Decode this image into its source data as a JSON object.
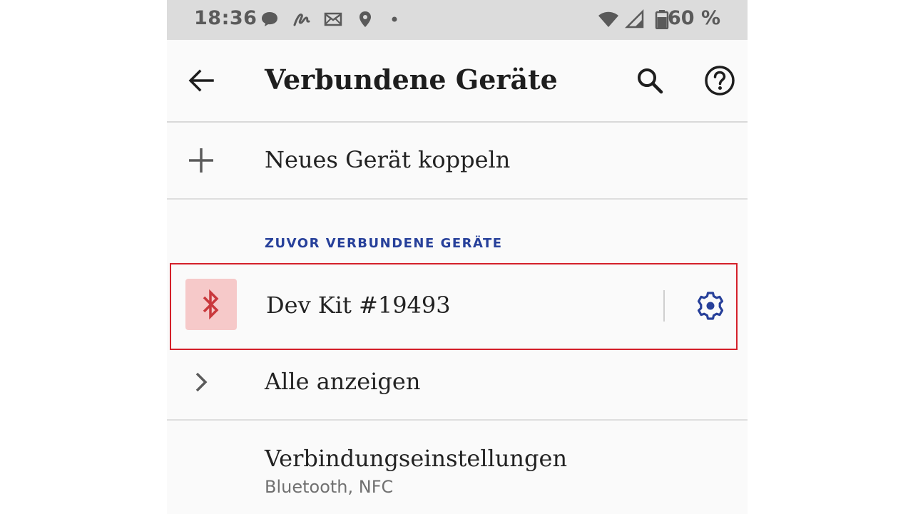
{
  "status_bar": {
    "time": "18:36",
    "battery": "60 %",
    "icons": [
      "chat-icon",
      "signature-icon",
      "mail-icon",
      "location-icon",
      "dot-icon",
      "wifi-icon",
      "cell-signal-icon",
      "battery-icon"
    ]
  },
  "app_bar": {
    "title": "Verbundene Geräte",
    "back_icon": "arrow-back-icon",
    "search_icon": "search-icon",
    "help_icon": "help-icon"
  },
  "pair_new": {
    "label": "Neues Gerät koppeln",
    "icon": "plus-icon"
  },
  "section": {
    "header": "ZUVOR VERBUNDENE GERÄTE"
  },
  "device": {
    "name": "Dev Kit #19493",
    "icon": "bluetooth-icon",
    "settings_icon": "gear-icon",
    "highlight_color": "#d4202a"
  },
  "show_all": {
    "label": "Alle anzeigen",
    "icon": "chevron-right-icon"
  },
  "connection_settings": {
    "label": "Verbindungseinstellungen",
    "sublabel": "Bluetooth, NFC"
  },
  "colors": {
    "accent": "#27409a",
    "bluetooth_tile": "#f6c9c9",
    "bluetooth_glyph": "#c9383c"
  }
}
